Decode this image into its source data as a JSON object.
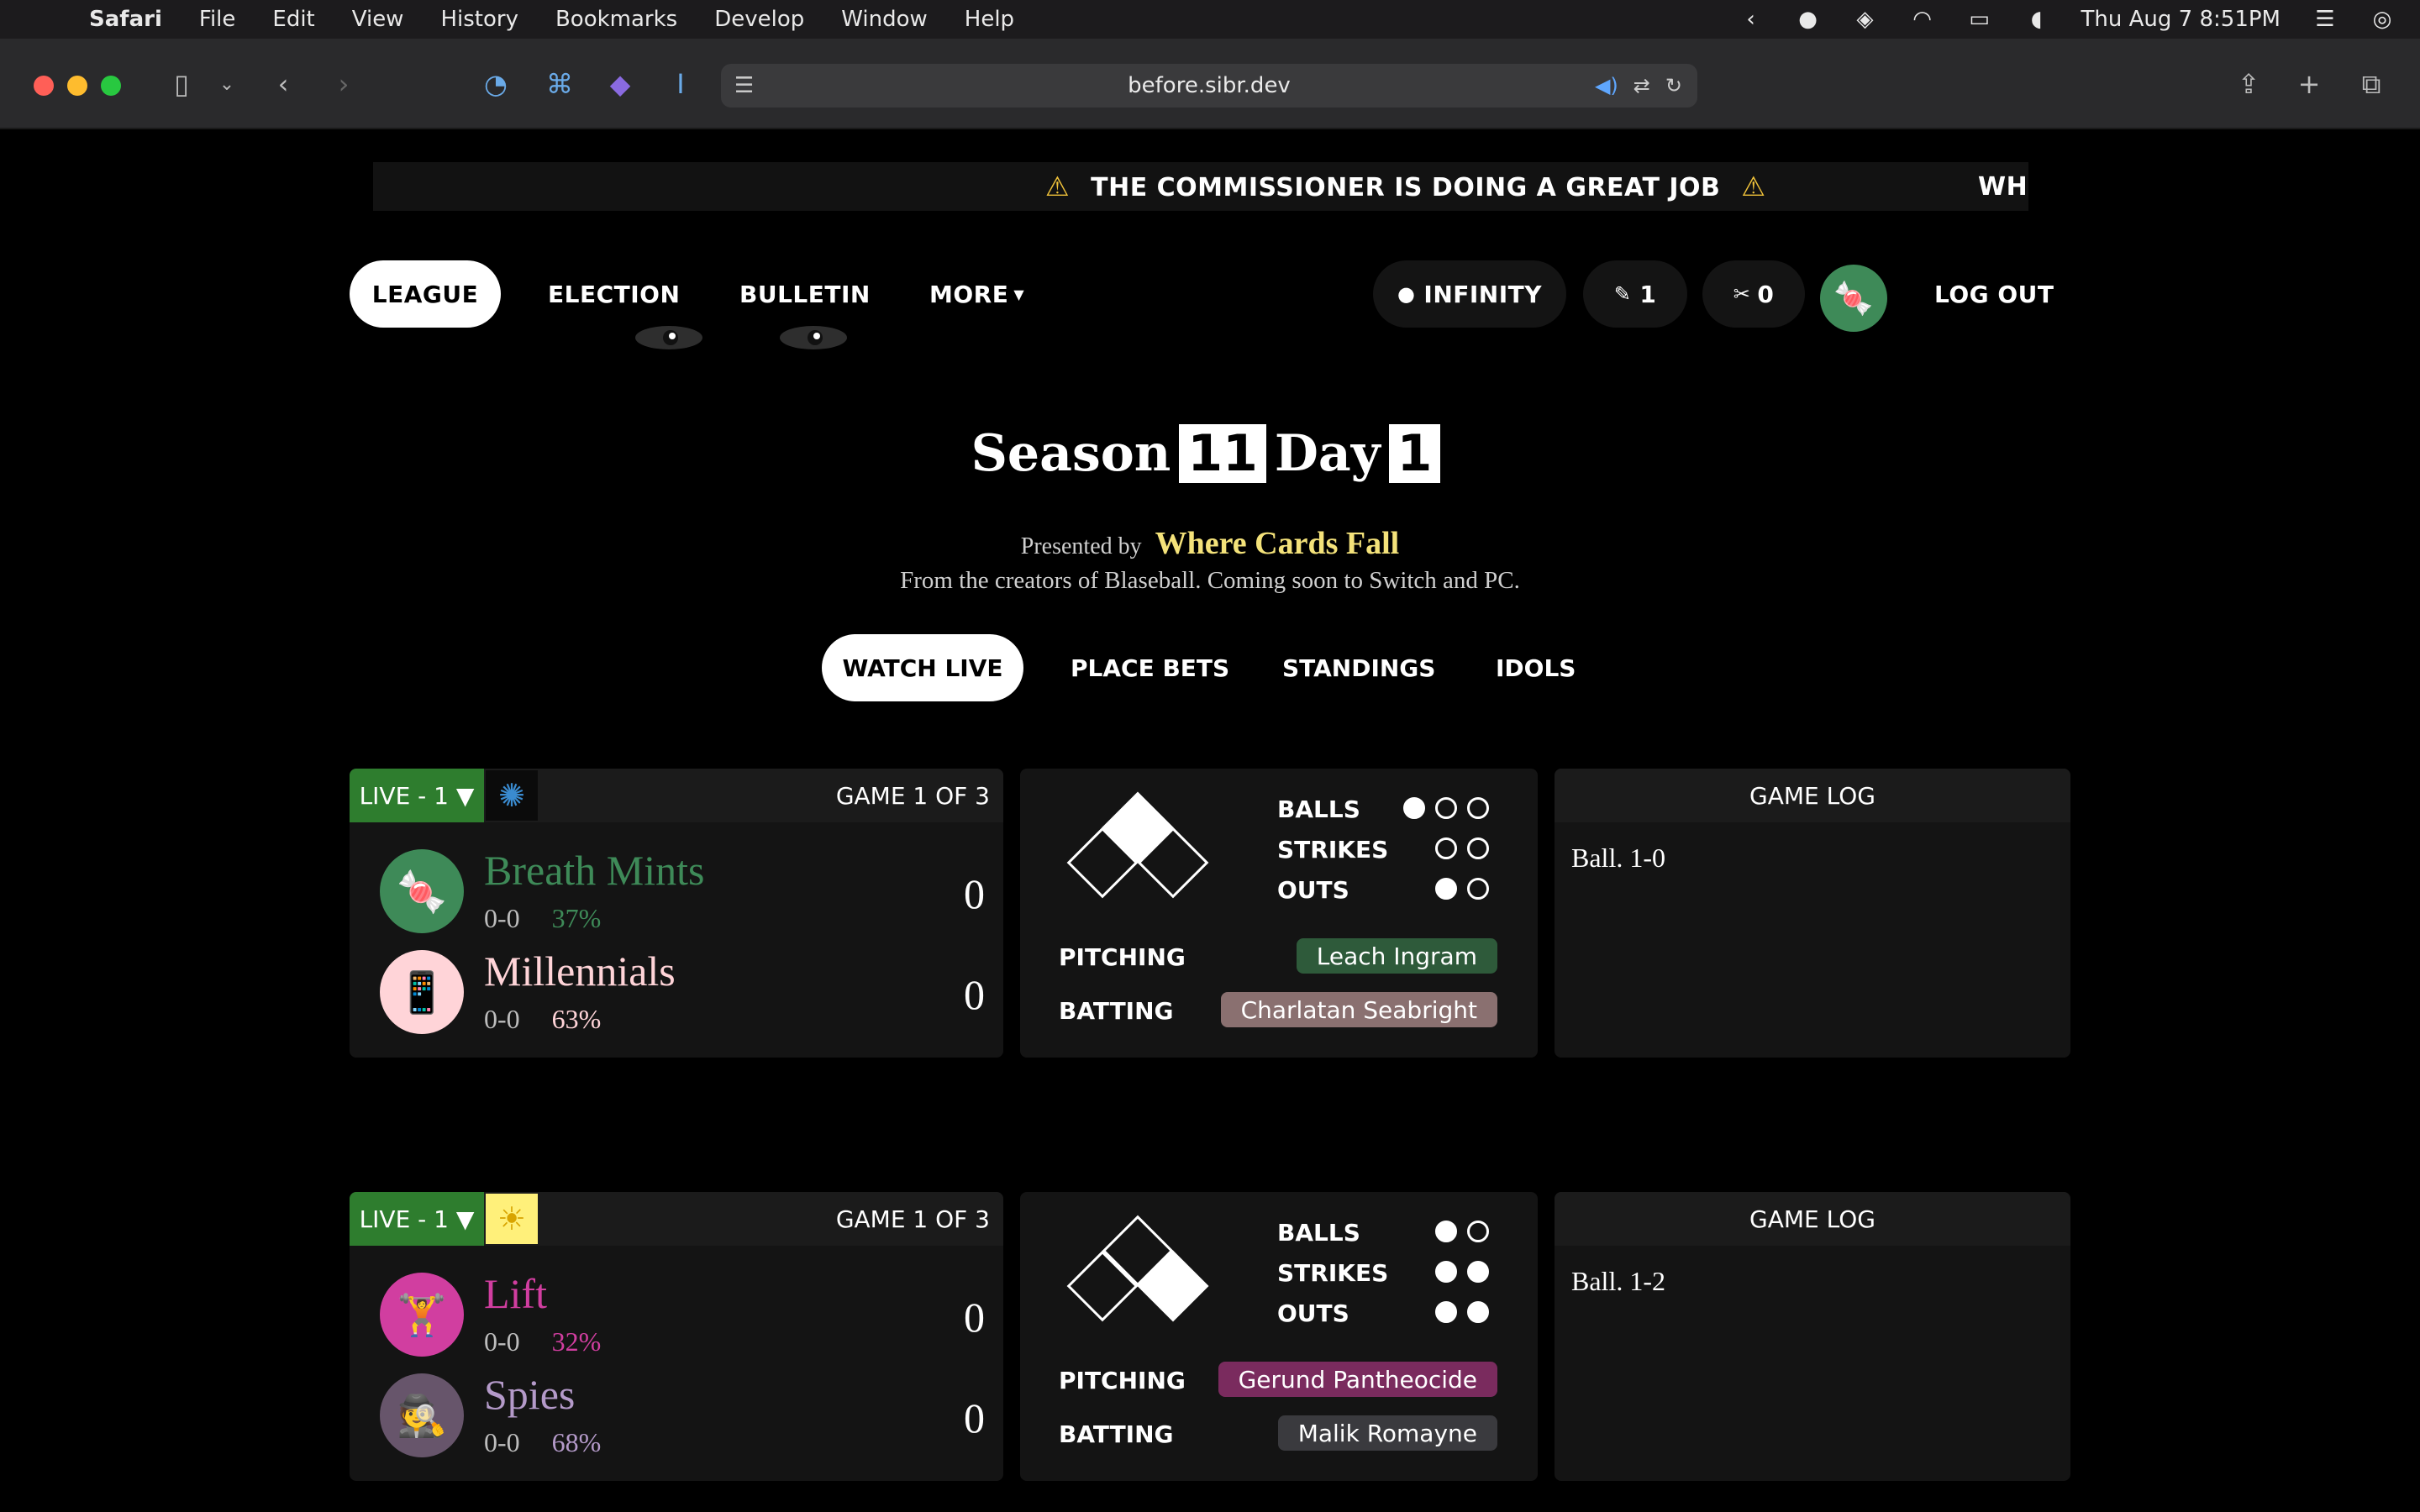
{
  "menubar": {
    "app_name": "Safari",
    "items": [
      "File",
      "Edit",
      "View",
      "History",
      "Bookmarks",
      "Develop",
      "Window",
      "Help"
    ],
    "clock": "Thu Aug 7  8:51PM"
  },
  "browser": {
    "url": "before.sibr.dev"
  },
  "ticker": {
    "message": "THE COMMISSIONER IS DOING A GREAT JOB",
    "next_fragment": "WHE",
    "warning_glyph": "⚠"
  },
  "nav": {
    "league": "LEAGUE",
    "election": "ELECTION",
    "bulletin": "BULLETIN",
    "more": "MORE",
    "coins": "INFINITY",
    "votes": "1",
    "snacks": "0",
    "logout": "LOG OUT",
    "avatar_emoji": "🍬"
  },
  "header": {
    "season_label": "Season",
    "season_number": "11",
    "day_label": "Day",
    "day_number": "1",
    "presented_by": "Presented by",
    "sponsor": "Where Cards Fall",
    "creators_line": "From the creators of Blaseball. Coming soon to Switch and PC."
  },
  "subnav": {
    "watch_live": "WATCH LIVE",
    "place_bets": "PLACE BETS",
    "standings": "STANDINGS",
    "idols": "IDOLS"
  },
  "labels": {
    "balls": "BALLS",
    "strikes": "STRIKES",
    "outs": "OUTS",
    "pitching": "PITCHING",
    "batting": "BATTING",
    "game_log": "GAME LOG"
  },
  "colors": {
    "live_green": "#2e7d2e",
    "sponsor_yellow": "#f4e27a"
  },
  "games": [
    {
      "live_label": "LIVE - 1 ▼",
      "weather_icon": "blackhole-icon",
      "game_of": "GAME 1 OF 3",
      "away": {
        "name": "Breath Mints",
        "record": "0-0",
        "pct": "37%",
        "score": "0",
        "emoji": "🍬",
        "color": "#3e8a58",
        "bg": "#3e8a58"
      },
      "home": {
        "name": "Millennials",
        "record": "0-0",
        "pct": "63%",
        "score": "0",
        "emoji": "📱",
        "color": "#ffd4d8",
        "bg": "#ffd4d8"
      },
      "balls": 1,
      "balls_max": 3,
      "strikes": 0,
      "strikes_max": 2,
      "outs": 1,
      "outs_max": 2,
      "bases_occupied": [
        2
      ],
      "pitcher": {
        "name": "Leach Ingram",
        "bg": "#2e5a3a"
      },
      "batter": {
        "name": "Charlatan Seabright",
        "bg": "#8a7070"
      },
      "log": "Ball. 1-0"
    },
    {
      "live_label": "LIVE - 1 ▼",
      "weather_icon": "sun-icon",
      "game_of": "GAME 1 OF 3",
      "away": {
        "name": "Lift",
        "record": "0-0",
        "pct": "32%",
        "score": "0",
        "emoji": "🏋",
        "color": "#d13ea0",
        "bg": "#d13ea0"
      },
      "home": {
        "name": "Spies",
        "record": "0-0",
        "pct": "68%",
        "score": "0",
        "emoji": "🕵",
        "color": "#b49ac9",
        "bg": "#67556b"
      },
      "balls": 1,
      "balls_max": 2,
      "strikes": 2,
      "strikes_max": 2,
      "outs": 2,
      "outs_max": 2,
      "bases_occupied": [
        1
      ],
      "pitcher": {
        "name": "Gerund Pantheocide",
        "bg": "#7a2b5e"
      },
      "batter": {
        "name": "Malik Romayne",
        "bg": "#3a3a3e"
      },
      "log": "Ball. 1-2"
    }
  ]
}
